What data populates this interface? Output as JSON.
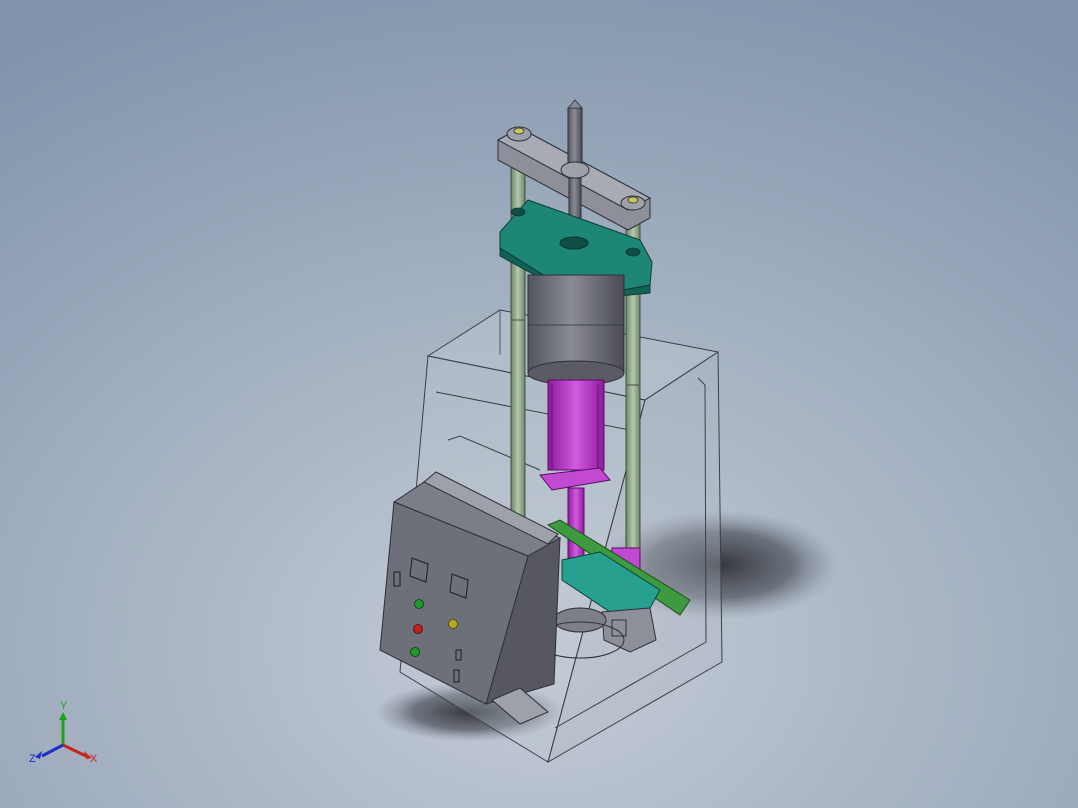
{
  "viewport": {
    "background_top": "#7f93ab",
    "background_bottom": "#c5ccd6"
  },
  "model": {
    "colors": {
      "enclosure_edge": "#3a3f47",
      "enclosure_fill": "#b9c1cc",
      "rod": "#9fb598",
      "crossbar": "#9a9ca6",
      "plate": "#1f8e7e",
      "cylinder": "#6f7079",
      "piston": "#b22fc0",
      "control_box": "#6c6e78",
      "carriage": "#2aa090",
      "rail": "#3f9a3f"
    },
    "indicators": {
      "green": "#1e9a2e",
      "red": "#c21e1e",
      "yellow": "#b8a81e"
    }
  },
  "triad": {
    "x_label": "X",
    "y_label": "Y",
    "z_label": "Z",
    "x_color": "#c8241e",
    "y_color": "#1ea21e",
    "z_color": "#1e2ec8"
  }
}
